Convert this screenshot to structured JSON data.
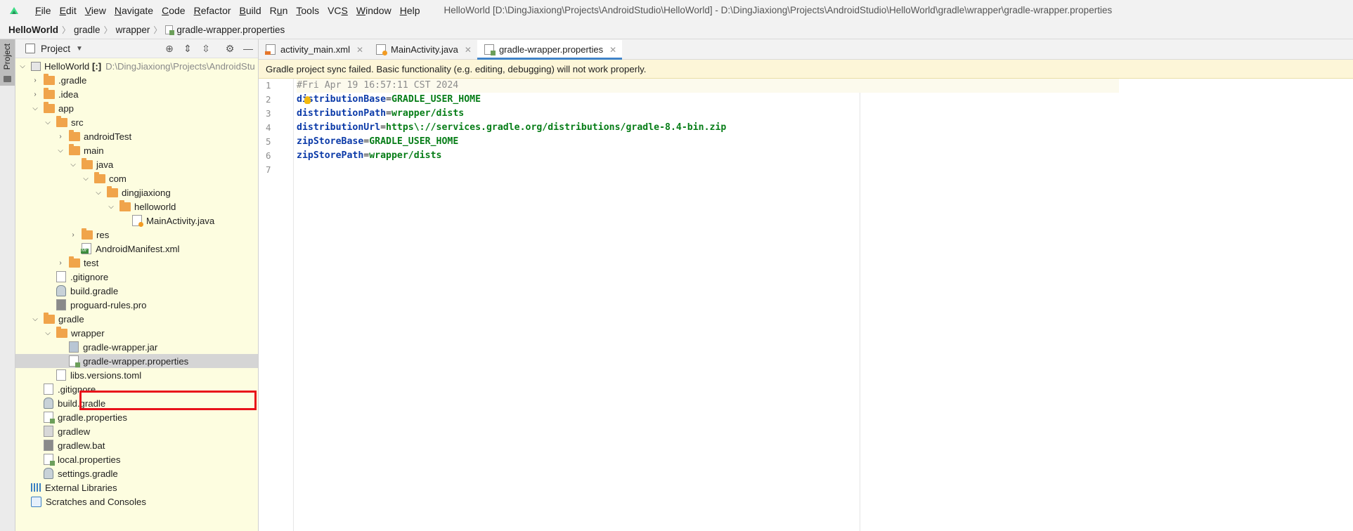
{
  "menubar": {
    "items": [
      {
        "pre": "",
        "ul": "F",
        "post": "ile"
      },
      {
        "pre": "",
        "ul": "E",
        "post": "dit"
      },
      {
        "pre": "",
        "ul": "V",
        "post": "iew"
      },
      {
        "pre": "",
        "ul": "N",
        "post": "avigate"
      },
      {
        "pre": "",
        "ul": "C",
        "post": "ode"
      },
      {
        "pre": "",
        "ul": "R",
        "post": "efactor"
      },
      {
        "pre": "",
        "ul": "B",
        "post": "uild"
      },
      {
        "pre": "R",
        "ul": "u",
        "post": "n"
      },
      {
        "pre": "",
        "ul": "T",
        "post": "ools"
      },
      {
        "pre": "VC",
        "ul": "S",
        "post": ""
      },
      {
        "pre": "",
        "ul": "W",
        "post": "indow"
      },
      {
        "pre": "",
        "ul": "H",
        "post": "elp"
      }
    ],
    "window_title": "HelloWorld [D:\\DingJiaxiong\\Projects\\AndroidStudio\\HelloWorld] - D:\\DingJiaxiong\\Projects\\AndroidStudio\\HelloWorld\\gradle\\wrapper\\gradle-wrapper.properties"
  },
  "breadcrumb": {
    "project": "HelloWorld",
    "c1": "gradle",
    "c2": "wrapper",
    "file": "gradle-wrapper.properties"
  },
  "toolstrip": {
    "project_tab": "Project"
  },
  "project_panel": {
    "title": "Project",
    "tree": {
      "root": "HelloWorld",
      "root_suffix": "[:]",
      "root_path": "D:\\DingJiaxiong\\Projects\\AndroidStu",
      "gradle_dir": ".gradle",
      "idea_dir": ".idea",
      "app": "app",
      "src": "src",
      "android_test": "androidTest",
      "main": "main",
      "java": "java",
      "com": "com",
      "dingjiaxiong": "dingjiaxiong",
      "helloworld": "helloworld",
      "main_activity": "MainActivity.java",
      "res": "res",
      "manifest": "AndroidManifest.xml",
      "test": "test",
      "app_gitignore": ".gitignore",
      "app_build_gradle": "build.gradle",
      "proguard": "proguard-rules.pro",
      "gradle": "gradle",
      "wrapper": "wrapper",
      "wrapper_jar": "gradle-wrapper.jar",
      "wrapper_props": "gradle-wrapper.properties",
      "libs_versions": "libs.versions.toml",
      "root_gitignore": ".gitignore",
      "root_build_gradle": "build.gradle",
      "gradle_properties": "gradle.properties",
      "gradlew": "gradlew",
      "gradlew_bat": "gradlew.bat",
      "local_properties": "local.properties",
      "settings_gradle": "settings.gradle",
      "external_libraries": "External Libraries",
      "scratches": "Scratches and Consoles"
    }
  },
  "editor": {
    "tabs": [
      {
        "label": "activity_main.xml"
      },
      {
        "label": "MainActivity.java"
      },
      {
        "label": "gradle-wrapper.properties"
      }
    ],
    "banner": "Gradle project sync failed. Basic functionality (e.g. editing, debugging) will not work properly.",
    "lines": {
      "n1": "1",
      "n2": "2",
      "n3": "3",
      "n4": "4",
      "n5": "5",
      "n6": "6",
      "n7": "7",
      "l1_comment": "#Fri Apr 19 16:57:11 CST 2024",
      "l2_key": "distributionBase",
      "l2_val": "GRADLE_USER_HOME",
      "l3_key": "distributionPath",
      "l3_val": "wrapper/dists",
      "l4_key": "distributionUrl",
      "l4_val": "https\\://services.gradle.org/distributions/gradle-8.4-bin.zip",
      "l5_key": "zipStoreBase",
      "l5_val": "GRADLE_USER_HOME",
      "l6_key": "zipStorePath",
      "l6_val": "wrapper/dists",
      "eq": "="
    }
  },
  "colors": {
    "accent": "#4083c9",
    "highlight": "#e8121a",
    "folder": "#f0a44b",
    "banner": "#fdf6d8"
  }
}
